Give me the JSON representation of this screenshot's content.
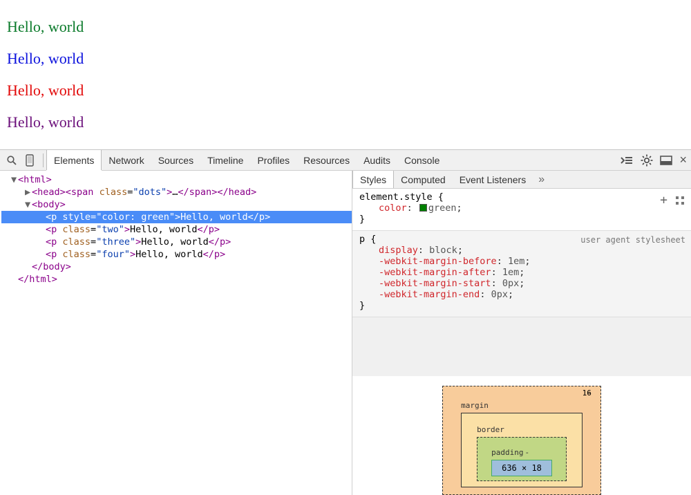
{
  "page": {
    "paragraphs": [
      {
        "text": "Hello, world",
        "color": "#0a7a2a"
      },
      {
        "text": "Hello, world",
        "color": "#0b11dd"
      },
      {
        "text": "Hello, world",
        "color": "#e20808"
      },
      {
        "text": "Hello, world",
        "color": "#6b0f7a"
      }
    ]
  },
  "devtools": {
    "tabs": [
      "Elements",
      "Network",
      "Sources",
      "Timeline",
      "Profiles",
      "Resources",
      "Audits",
      "Console"
    ],
    "active_tab": "Elements"
  },
  "dom": {
    "lines": [
      {
        "indent": 0,
        "arrow": "▼",
        "html": "<html>",
        "kind": "open"
      },
      {
        "indent": 1,
        "arrow": "▶",
        "html": "<head>…</head>",
        "kind": "collapsed"
      },
      {
        "indent": 1,
        "arrow": "▼",
        "html": "<body>",
        "kind": "open"
      },
      {
        "indent": 2,
        "arrow": "",
        "html": "<p style=\"color: green\">Hello, world</p>",
        "kind": "node",
        "selected": true
      },
      {
        "indent": 2,
        "arrow": "",
        "html": "<p class=\"two\">Hello, world</p>",
        "kind": "node"
      },
      {
        "indent": 2,
        "arrow": "",
        "html": "<p class=\"three\">Hello, world</p>",
        "kind": "node"
      },
      {
        "indent": 2,
        "arrow": "",
        "html": "<p class=\"four\">Hello, world</p>",
        "kind": "node"
      },
      {
        "indent": 1,
        "arrow": "",
        "html": "</body>",
        "kind": "close"
      },
      {
        "indent": 0,
        "arrow": "",
        "html": "</html>",
        "kind": "close"
      }
    ]
  },
  "sidebar": {
    "tabs": [
      "Styles",
      "Computed",
      "Event Listeners"
    ],
    "active": "Styles",
    "more_glyph": "»"
  },
  "styles": {
    "element_rule": {
      "selector": "element.style {",
      "props": [
        {
          "name": "color",
          "value": "green",
          "swatch": "#008000"
        }
      ],
      "close": "}"
    },
    "ua_rule": {
      "selector": "p {",
      "origin": "user agent stylesheet",
      "props": [
        {
          "name": "display",
          "value": "block"
        },
        {
          "name": "-webkit-margin-before",
          "value": "1em"
        },
        {
          "name": "-webkit-margin-after",
          "value": "1em"
        },
        {
          "name": "-webkit-margin-start",
          "value": "0px"
        },
        {
          "name": "-webkit-margin-end",
          "value": "0px"
        }
      ],
      "close": "}"
    }
  },
  "metrics": {
    "margin_label": "margin",
    "margin_top": "16",
    "border_label": "border",
    "border_val": "-",
    "padding_label": "padding",
    "padding_val": "-",
    "content": "636 × 18"
  },
  "icons": {
    "add": "+",
    "close": "×",
    "chevrons": "»"
  }
}
